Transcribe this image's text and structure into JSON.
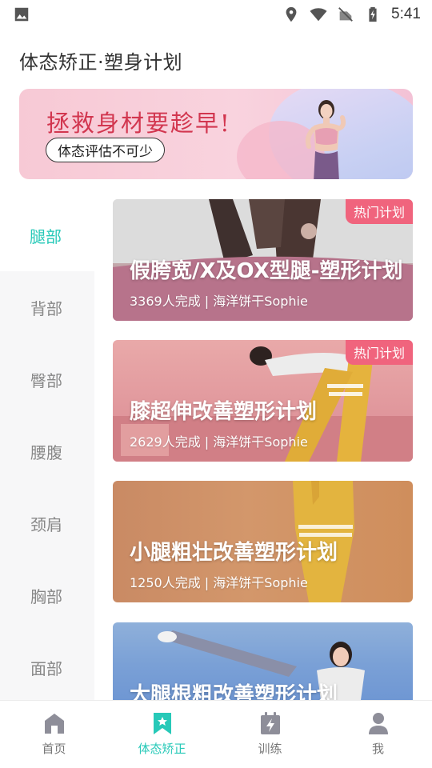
{
  "status_bar": {
    "time": "5:41",
    "icons": [
      "image-icon",
      "location-icon",
      "wifi-icon",
      "no-signal-icon",
      "battery-charging-icon"
    ]
  },
  "header": {
    "title": "体态矫正·塑身计划"
  },
  "banner": {
    "title": "拯救身材要趁早!",
    "subtitle": "体态评估不可少"
  },
  "sidebar": {
    "items": [
      {
        "label": "腿部",
        "active": true
      },
      {
        "label": "背部",
        "active": false
      },
      {
        "label": "臀部",
        "active": false
      },
      {
        "label": "腰腹",
        "active": false
      },
      {
        "label": "颈肩",
        "active": false
      },
      {
        "label": "胸部",
        "active": false
      },
      {
        "label": "面部",
        "active": false
      }
    ]
  },
  "plans": [
    {
      "title": "假胯宽/X及OX型腿-塑形计划",
      "meta": "3369人完成 | 海洋饼干Sophie",
      "badge": "热门计划"
    },
    {
      "title": "膝超伸改善塑形计划",
      "meta": "2629人完成 | 海洋饼干Sophie",
      "badge": "热门计划"
    },
    {
      "title": "小腿粗壮改善塑形计划",
      "meta": "1250人完成 | 海洋饼干Sophie",
      "badge": ""
    },
    {
      "title": "大腿根粗改善塑形计划",
      "meta": "",
      "badge": ""
    }
  ],
  "bottom_nav": {
    "tabs": [
      {
        "label": "首页",
        "icon": "home-icon",
        "active": false
      },
      {
        "label": "体态矫正",
        "icon": "bookmark-star-icon",
        "active": true
      },
      {
        "label": "训练",
        "icon": "calendar-bolt-icon",
        "active": false
      },
      {
        "label": "我",
        "icon": "person-icon",
        "active": false
      }
    ]
  },
  "colors": {
    "accent": "#27c9b8",
    "badge": "#f0647d",
    "banner_title": "#d2364f",
    "inactive_text": "#888888"
  }
}
